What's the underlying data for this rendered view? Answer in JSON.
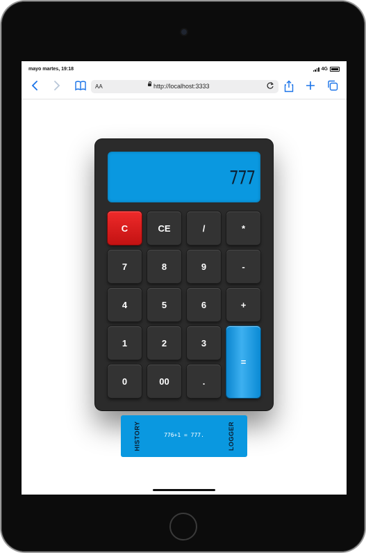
{
  "status_bar": {
    "time": "mayo martes, 19:18",
    "network": "4G"
  },
  "browser": {
    "text_size_label": "AA",
    "url": "http://localhost:3333",
    "icons": {
      "back": "chevron-left-icon",
      "forward": "chevron-right-icon",
      "bookmarks": "book-icon",
      "lock": "lock-icon",
      "reload": "reload-icon",
      "share": "share-icon",
      "new_tab": "plus-icon",
      "tabs": "tabs-icon"
    }
  },
  "calculator": {
    "display_value": "777",
    "display_color": "#0a98e0",
    "keys": [
      {
        "label": "C",
        "style": "red"
      },
      {
        "label": "CE",
        "style": "dark"
      },
      {
        "label": "/",
        "style": "dark"
      },
      {
        "label": "*",
        "style": "dark"
      },
      {
        "label": "7",
        "style": "dark"
      },
      {
        "label": "8",
        "style": "dark"
      },
      {
        "label": "9",
        "style": "dark"
      },
      {
        "label": "-",
        "style": "dark"
      },
      {
        "label": "4",
        "style": "dark"
      },
      {
        "label": "5",
        "style": "dark"
      },
      {
        "label": "6",
        "style": "dark"
      },
      {
        "label": "+",
        "style": "dark"
      },
      {
        "label": "1",
        "style": "dark"
      },
      {
        "label": "2",
        "style": "dark"
      },
      {
        "label": "3",
        "style": "dark"
      },
      {
        "label": "=",
        "style": "blue"
      },
      {
        "label": "0",
        "style": "dark"
      },
      {
        "label": "00",
        "style": "dark"
      },
      {
        "label": ".",
        "style": "dark"
      }
    ]
  },
  "logger": {
    "history_label": "HISTORY",
    "logger_label": "LOGGER",
    "entry": "776+1 = 777."
  }
}
